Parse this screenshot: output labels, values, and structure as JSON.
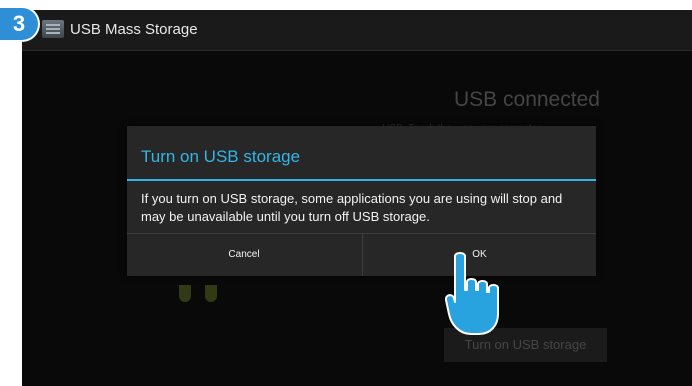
{
  "step": {
    "number": "3"
  },
  "action_bar": {
    "title": "USB Mass Storage",
    "icon": "usb-storage-app-icon"
  },
  "background": {
    "heading": "USB connected",
    "description": "...USB. Touch the ...en your computer",
    "button_label": "Turn on USB storage"
  },
  "dialog": {
    "title": "Turn on USB storage",
    "message": "If you turn on USB storage, some applications you are using will stop and may be unavailable until you turn off USB storage.",
    "cancel_label": "Cancel",
    "ok_label": "OK"
  },
  "colors": {
    "accent": "#33b5e5",
    "badge": "#2f8fd6",
    "hand": "#29a3e0"
  },
  "icons": {
    "pointer": "tap-hand-icon"
  }
}
